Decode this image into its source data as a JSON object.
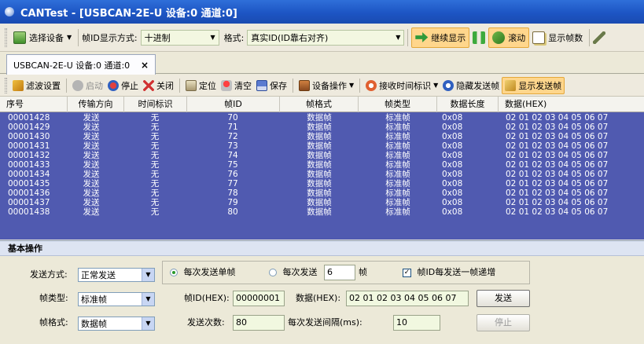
{
  "window": {
    "title": "CANTest - [USBCAN-2E-U 设备:0 通道:0]"
  },
  "toolbar": {
    "select_device": "选择设备",
    "frame_id_format_label": "帧ID显示方式:",
    "frame_id_format_value": "十进制",
    "format_label": "格式:",
    "format_value": "真实ID(ID靠右对齐)",
    "continue_display": "继续显示",
    "scroll": "滚动",
    "show_frame_count": "显示帧数"
  },
  "tab": {
    "label": "USBCAN-2E-U 设备:0 通道:0",
    "close": "×"
  },
  "toolbar2": {
    "filter_settings": "滤波设置",
    "start": "启动",
    "stop": "停止",
    "close": "关闭",
    "locate": "定位",
    "clear": "清空",
    "save": "保存",
    "device_ops": "设备操作",
    "recv_time_flag": "接收时间标识",
    "hide_send_frames": "隐藏发送帧",
    "show_send_frames": "显示发送帧"
  },
  "table": {
    "headers": [
      "序号",
      "传输方向",
      "时间标识",
      "帧ID",
      "帧格式",
      "帧类型",
      "数据长度",
      "数据(HEX)"
    ],
    "rows": [
      [
        "00001428",
        "发送",
        "无",
        "70",
        "数据帧",
        "标准帧",
        "0x08",
        "02 01 02 03 04 05 06 07"
      ],
      [
        "00001429",
        "发送",
        "无",
        "71",
        "数据帧",
        "标准帧",
        "0x08",
        "02 01 02 03 04 05 06 07"
      ],
      [
        "00001430",
        "发送",
        "无",
        "72",
        "数据帧",
        "标准帧",
        "0x08",
        "02 01 02 03 04 05 06 07"
      ],
      [
        "00001431",
        "发送",
        "无",
        "73",
        "数据帧",
        "标准帧",
        "0x08",
        "02 01 02 03 04 05 06 07"
      ],
      [
        "00001432",
        "发送",
        "无",
        "74",
        "数据帧",
        "标准帧",
        "0x08",
        "02 01 02 03 04 05 06 07"
      ],
      [
        "00001433",
        "发送",
        "无",
        "75",
        "数据帧",
        "标准帧",
        "0x08",
        "02 01 02 03 04 05 06 07"
      ],
      [
        "00001434",
        "发送",
        "无",
        "76",
        "数据帧",
        "标准帧",
        "0x08",
        "02 01 02 03 04 05 06 07"
      ],
      [
        "00001435",
        "发送",
        "无",
        "77",
        "数据帧",
        "标准帧",
        "0x08",
        "02 01 02 03 04 05 06 07"
      ],
      [
        "00001436",
        "发送",
        "无",
        "78",
        "数据帧",
        "标准帧",
        "0x08",
        "02 01 02 03 04 05 06 07"
      ],
      [
        "00001437",
        "发送",
        "无",
        "79",
        "数据帧",
        "标准帧",
        "0x08",
        "02 01 02 03 04 05 06 07"
      ],
      [
        "00001438",
        "发送",
        "无",
        "80",
        "数据帧",
        "标准帧",
        "0x08",
        "02 01 02 03 04 05 06 07"
      ]
    ]
  },
  "panel": {
    "title": "基本操作",
    "send_mode_label": "发送方式:",
    "send_mode_value": "正常发送",
    "single_frame_label": "每次发送单帧",
    "multi_frame_label": "每次发送",
    "multi_frame_count": "6",
    "multi_frame_unit": "帧",
    "id_increment_label": "帧ID每发送一帧递增",
    "frame_type_label": "帧类型:",
    "frame_type_value": "标准帧",
    "frame_id_label": "帧ID(HEX):",
    "frame_id_value": "00000001",
    "data_label": "数据(HEX):",
    "data_value": "02 01 02 03 04 05 06 07",
    "send_button": "发送",
    "frame_format_label": "帧格式:",
    "frame_format_value": "数据帧",
    "send_count_label": "发送次数:",
    "send_count_value": "80",
    "interval_label": "每次发送间隔(ms):",
    "interval_value": "10",
    "stop_button": "停止"
  }
}
